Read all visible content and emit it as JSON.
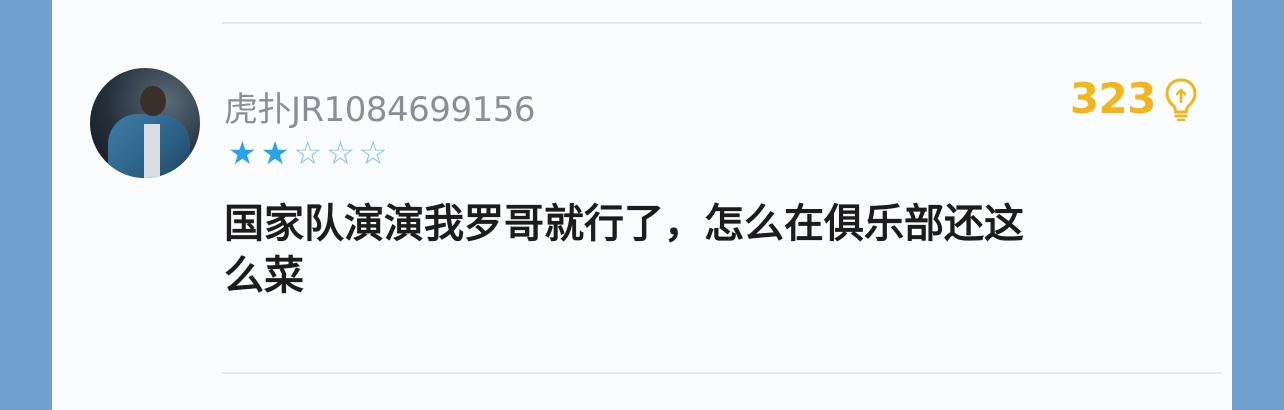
{
  "comment": {
    "username": "虎扑JR1084699156",
    "rating": 2,
    "rating_max": 5,
    "likes": "323",
    "content_line1": "国家队演演我罗哥就行了，怎么在俱乐部还这",
    "content_line2": "么菜",
    "avatar_icon": "user-avatar-photo",
    "like_icon": "lightbulb-icon",
    "star_filled_icon": "star-filled-icon",
    "star_empty_icon": "star-outline-icon"
  },
  "colors": {
    "page_background": "#6fa0cf",
    "card_background": "#fbfcfd",
    "username": "#8a8f94",
    "star": "#2aa3ee",
    "likes": "#f3b51c",
    "content": "#1c1c1c"
  }
}
